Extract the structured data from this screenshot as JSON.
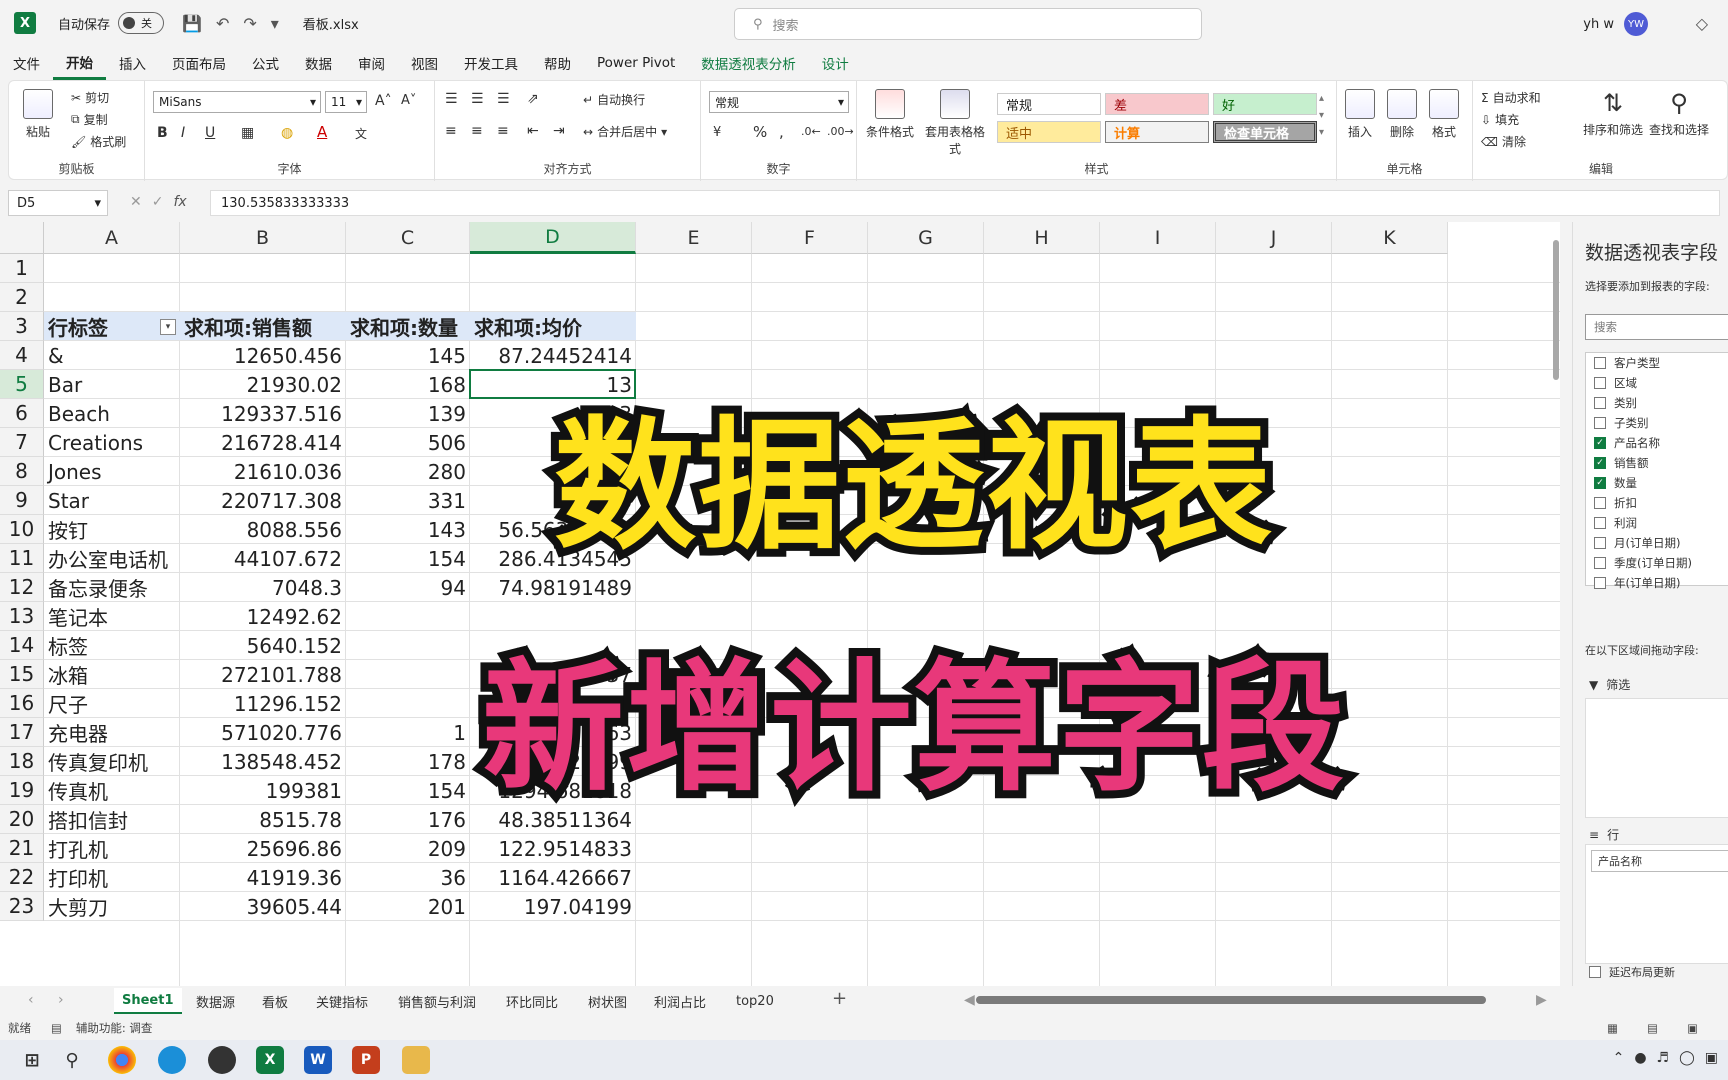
{
  "titlebar": {
    "autosave_label": "自动保存",
    "autosave_state": "关",
    "filename": "看板.xlsx",
    "search_placeholder": "搜索",
    "user_name": "yh w",
    "user_initials": "YW"
  },
  "menu": [
    "文件",
    "开始",
    "插入",
    "页面布局",
    "公式",
    "数据",
    "审阅",
    "视图",
    "开发工具",
    "帮助",
    "Power Pivot",
    "数据透视表分析",
    "设计"
  ],
  "ribbon": {
    "clipboard": {
      "paste": "粘贴",
      "cut": "剪切",
      "copy": "复制",
      "format_painter": "格式刷",
      "label": "剪贴板"
    },
    "font": {
      "name": "MiSans",
      "size": "11",
      "label": "字体"
    },
    "align": {
      "wrap": "自动换行",
      "merge": "合并后居中",
      "label": "对齐方式"
    },
    "number": {
      "format": "常规",
      "label": "数字"
    },
    "styles": {
      "conditional": "条件格式",
      "table": "套用表格格式",
      "normal": "常规",
      "bad": "差",
      "good": "好",
      "neutral": "适中",
      "calc": "计算",
      "check": "检查单元格",
      "label": "样式"
    },
    "cells": {
      "insert": "插入",
      "delete": "删除",
      "format": "格式",
      "label": "单元格"
    },
    "edit": {
      "autosum": "自动求和",
      "fill": "填充",
      "clear": "清除",
      "sort": "排序和筛选",
      "find": "查找和选择",
      "label": "编辑"
    }
  },
  "formula": {
    "namebox": "D5",
    "value": "130.535833333333"
  },
  "columns": [
    "A",
    "B",
    "C",
    "D",
    "E",
    "F",
    "G",
    "H",
    "I",
    "J",
    "K"
  ],
  "rows": [
    "1",
    "2",
    "3",
    "4",
    "5",
    "6",
    "7",
    "8",
    "9",
    "10",
    "11",
    "12",
    "13",
    "14",
    "15",
    "16",
    "17",
    "18",
    "19",
    "20",
    "21",
    "22",
    "23"
  ],
  "pivot_header": [
    "行标签",
    "求和项:销售额",
    "求和项:数量",
    "求和项:均价"
  ],
  "pivot_rows": [
    [
      "&",
      "12650.456",
      "145",
      "87.24452414"
    ],
    [
      "Bar",
      "21930.02",
      "168",
      "13"
    ],
    [
      "Beach",
      "129337.516",
      "139",
      "93"
    ],
    [
      "Creations",
      "216728.414",
      "506",
      "4"
    ],
    [
      "Jones",
      "21610.036",
      "280",
      ""
    ],
    [
      "Star",
      "220717.308",
      "331",
      "6"
    ],
    [
      "按钉",
      "8088.556",
      "143",
      "56.56332867"
    ],
    [
      "办公室电话机",
      "44107.672",
      "154",
      "286.4134545"
    ],
    [
      "备忘录便条",
      "7048.3",
      "94",
      "74.98191489"
    ],
    [
      "笔记本",
      "12492.62",
      "",
      ""
    ],
    [
      "标签",
      "5640.152",
      "",
      ""
    ],
    [
      "冰箱",
      "272101.788",
      "",
      "37"
    ],
    [
      "尺子",
      "11296.152",
      "",
      ""
    ],
    [
      "充电器",
      "571020.776",
      "1",
      "75863"
    ],
    [
      "传真复印机",
      "138548.452",
      "178",
      "778.3620899"
    ],
    [
      "传真机",
      "199381",
      "154",
      "1294.681818"
    ],
    [
      "搭扣信封",
      "8515.78",
      "176",
      "48.38511364"
    ],
    [
      "打孔机",
      "25696.86",
      "209",
      "122.9514833"
    ],
    [
      "打印机",
      "41919.36",
      "36",
      "1164.426667"
    ],
    [
      "大剪刀",
      "39605.44",
      "201",
      "197.04199"
    ]
  ],
  "overlay": {
    "line1": "数据透视表",
    "line2": "新增计算字段"
  },
  "pane": {
    "title": "数据透视表字段",
    "subtitle": "选择要添加到报表的字段:",
    "search": "搜索",
    "fields": [
      {
        "name": "客户类型",
        "checked": false
      },
      {
        "name": "区域",
        "checked": false
      },
      {
        "name": "类别",
        "checked": false
      },
      {
        "name": "子类别",
        "checked": false
      },
      {
        "name": "产品名称",
        "checked": true
      },
      {
        "name": "销售额",
        "checked": true
      },
      {
        "name": "数量",
        "checked": true
      },
      {
        "name": "折扣",
        "checked": false
      },
      {
        "name": "利润",
        "checked": false
      },
      {
        "name": "月(订单日期)",
        "checked": false
      },
      {
        "name": "季度(订单日期)",
        "checked": false
      },
      {
        "name": "年(订单日期)",
        "checked": false
      }
    ],
    "drag_hint": "在以下区域间拖动字段:",
    "filter_label": "筛选",
    "rows_label": "行",
    "rows_value": "产品名称",
    "defer": "延迟布局更新"
  },
  "sheets": [
    "Sheet1",
    "数据源",
    "看板",
    "关键指标",
    "销售额与利润",
    "环比同比",
    "树状图",
    "利润占比",
    "top20"
  ],
  "status": {
    "ready": "就绪",
    "accessibility": "辅助功能: 调查"
  },
  "colors": {
    "accent": "#107c41",
    "overlay1": "#ffe21c",
    "overlay2": "#e8387a",
    "pivot_header": "#dde8f8"
  }
}
